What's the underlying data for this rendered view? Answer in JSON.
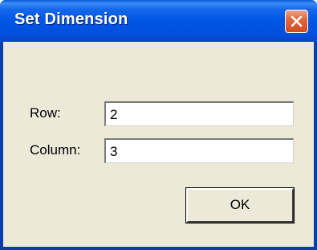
{
  "window": {
    "title": "Set Dimension",
    "close_icon": "close-icon"
  },
  "form": {
    "row_label": "Row:",
    "row_value": "2",
    "column_label": "Column:",
    "column_value": "3"
  },
  "buttons": {
    "ok_label": "OK"
  },
  "colors": {
    "titlebar": "#0055e5",
    "body": "#ece9d8",
    "close_button": "#d24a1f"
  }
}
